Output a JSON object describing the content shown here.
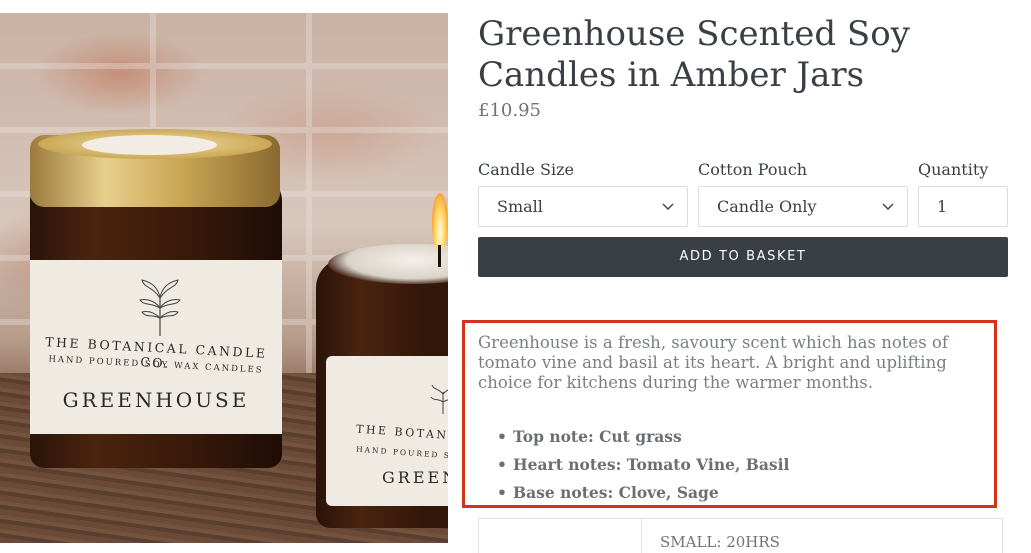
{
  "product": {
    "title": "Greenhouse Scented Soy Candles in Amber Jars",
    "price": "£10.95"
  },
  "image": {
    "label_brand": "THE BOTANICAL CANDLE CO.",
    "label_sub": "HAND POURED SOY WAX CANDLES",
    "label_name": "GREENHOUSE",
    "label2_brand": "THE BOTANI",
    "label2_sub": "HAND POURED S",
    "label2_name": "GREEN"
  },
  "options": {
    "size": {
      "label": "Candle Size",
      "value": "Small"
    },
    "pouch": {
      "label": "Cotton Pouch",
      "value": "Candle Only"
    },
    "quantity": {
      "label": "Quantity",
      "value": "1"
    }
  },
  "basket_label": "ADD TO BASKET",
  "description": {
    "text": "Greenhouse is a fresh, savoury scent which has notes of tomato vine and basil at its heart. A bright and uplifting choice for kitchens during the warmer months.",
    "notes": [
      "Top note: Cut grass",
      "Heart notes: Tomato Vine, Basil",
      "Base notes: Clove, Sage"
    ]
  },
  "table": {
    "cell": "SMALL: 20HRS"
  },
  "colors": {
    "button_bg": "#3a3f45",
    "highlight_border": "#d4321c"
  }
}
